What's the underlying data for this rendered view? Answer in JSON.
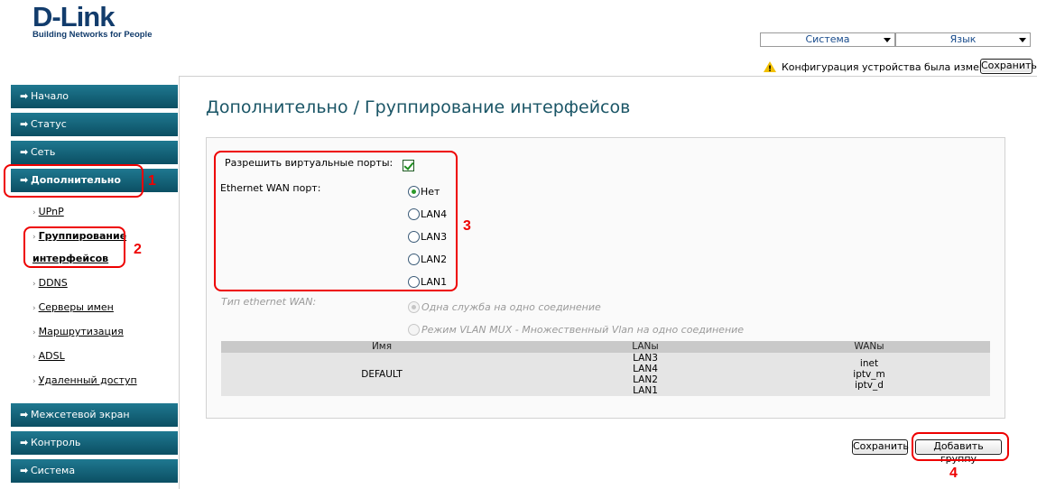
{
  "brand": {
    "logo": "D-Link",
    "tagline": "Building Networks for People"
  },
  "header": {
    "system_select": "Система",
    "language_select": "Язык",
    "notice": "Конфигурация устройства была изменена",
    "save_label": "Сохранить"
  },
  "sidebar": {
    "items": [
      {
        "label": "Начало"
      },
      {
        "label": "Статус"
      },
      {
        "label": "Сеть"
      },
      {
        "label": "Дополнительно"
      },
      {
        "label": "Межсетевой экран"
      },
      {
        "label": "Контроль"
      },
      {
        "label": "Система"
      }
    ],
    "subitems": [
      {
        "label": "UPnP"
      },
      {
        "label": "Группирование"
      },
      {
        "label": "интерфейсов"
      },
      {
        "label": "DDNS"
      },
      {
        "label": "Серверы имен"
      },
      {
        "label": "Маршрутизация"
      },
      {
        "label": "ADSL"
      },
      {
        "label": "Удаленный доступ"
      }
    ]
  },
  "main": {
    "title": "Дополнительно /  Группирование интерфейсов",
    "virtual_ports_label": "Разрешить виртуальные порты:",
    "virtual_ports_checked": true,
    "wan_port_label": "Ethernet WAN порт:",
    "wan_port_options": [
      "Нет",
      "LAN4",
      "LAN3",
      "LAN2",
      "LAN1"
    ],
    "wan_port_selected": "Нет",
    "wan_type_label": "Тип ethernet WAN:",
    "wan_type_options": [
      "Одна служба на одно соединение",
      "Режим VLAN MUX - Множественный Vlan на одно соединение"
    ],
    "wan_type_selected": "Одна служба на одно соединение",
    "table": {
      "headers": [
        "Имя",
        "LANы",
        "WANы"
      ],
      "rows": [
        {
          "name": "DEFAULT",
          "lans": [
            "LAN3",
            "LAN4",
            "LAN2",
            "LAN1"
          ],
          "wans": [
            "inet",
            "iptv_m",
            "iptv_d"
          ]
        }
      ]
    },
    "save_label": "Сохранить",
    "add_group_label": "Добавить группу"
  },
  "annotations": [
    "1",
    "2",
    "3",
    "4"
  ],
  "colors": {
    "nav_bg": "#0b5a6e",
    "accent_title": "#1a5566",
    "annotation": "#ee0000",
    "brand": "#123c6c"
  }
}
